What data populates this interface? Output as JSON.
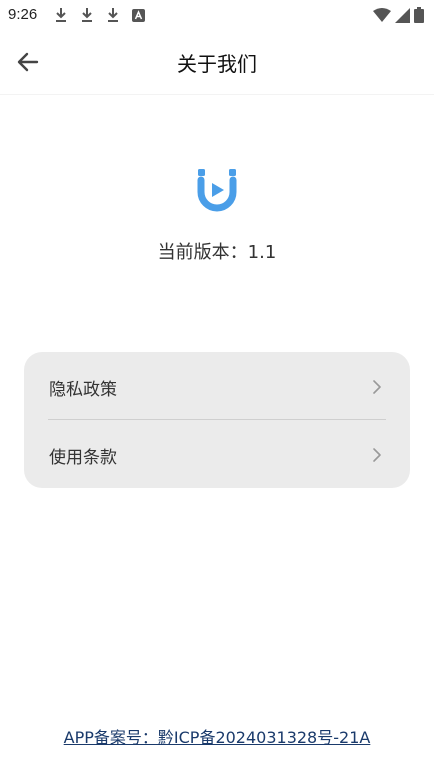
{
  "status_bar": {
    "time": "9:26",
    "left_icons": [
      "download-icon",
      "download-icon",
      "download-icon",
      "notification-a-icon"
    ],
    "right_icons": [
      "wifi-icon",
      "signal-icon",
      "battery-icon"
    ]
  },
  "app_bar": {
    "title": "关于我们",
    "back_icon": "arrow-back-icon"
  },
  "about": {
    "logo_icon": "app-logo-icon",
    "version_text": "当前版本：1.1",
    "logo_color": "#4a9ee8"
  },
  "menu": {
    "items": [
      {
        "label": "隐私政策",
        "icon": "chevron-right-icon"
      },
      {
        "label": "使用条款",
        "icon": "chevron-right-icon"
      }
    ],
    "background": "#ebebeb"
  },
  "footer": {
    "record_text": "APP备案号：黔ICP备2024031328号-21A",
    "link_color": "#1a3a6b"
  }
}
